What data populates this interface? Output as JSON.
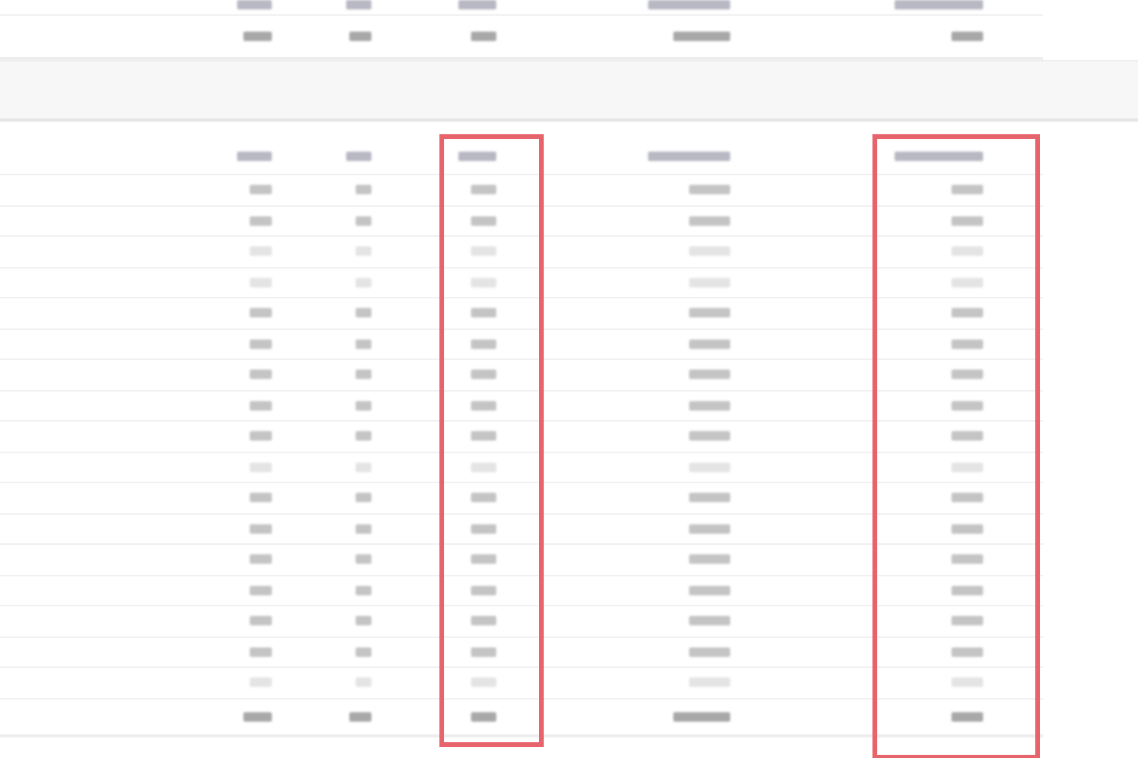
{
  "upper_table": {
    "rows": [
      {
        "kind": "header",
        "faded": false
      },
      {
        "kind": "total",
        "faded": false
      }
    ]
  },
  "lower_table": {
    "columns": [
      {
        "highlighted": false
      },
      {
        "highlighted": false
      },
      {
        "highlighted": true
      },
      {
        "highlighted": false
      },
      {
        "highlighted": true
      }
    ],
    "rows": [
      {
        "kind": "header",
        "faded": false
      },
      {
        "kind": "data",
        "faded": false
      },
      {
        "kind": "data",
        "faded": false
      },
      {
        "kind": "data",
        "faded": true
      },
      {
        "kind": "data",
        "faded": true
      },
      {
        "kind": "data",
        "faded": false
      },
      {
        "kind": "data",
        "faded": false
      },
      {
        "kind": "data",
        "faded": false
      },
      {
        "kind": "data",
        "faded": false
      },
      {
        "kind": "data",
        "faded": false
      },
      {
        "kind": "data",
        "faded": true
      },
      {
        "kind": "data",
        "faded": false
      },
      {
        "kind": "data",
        "faded": false
      },
      {
        "kind": "data",
        "faded": false
      },
      {
        "kind": "data",
        "faded": false
      },
      {
        "kind": "data",
        "faded": false
      },
      {
        "kind": "data",
        "faded": false
      },
      {
        "kind": "data",
        "faded": true
      },
      {
        "kind": "total",
        "faded": false
      }
    ]
  }
}
